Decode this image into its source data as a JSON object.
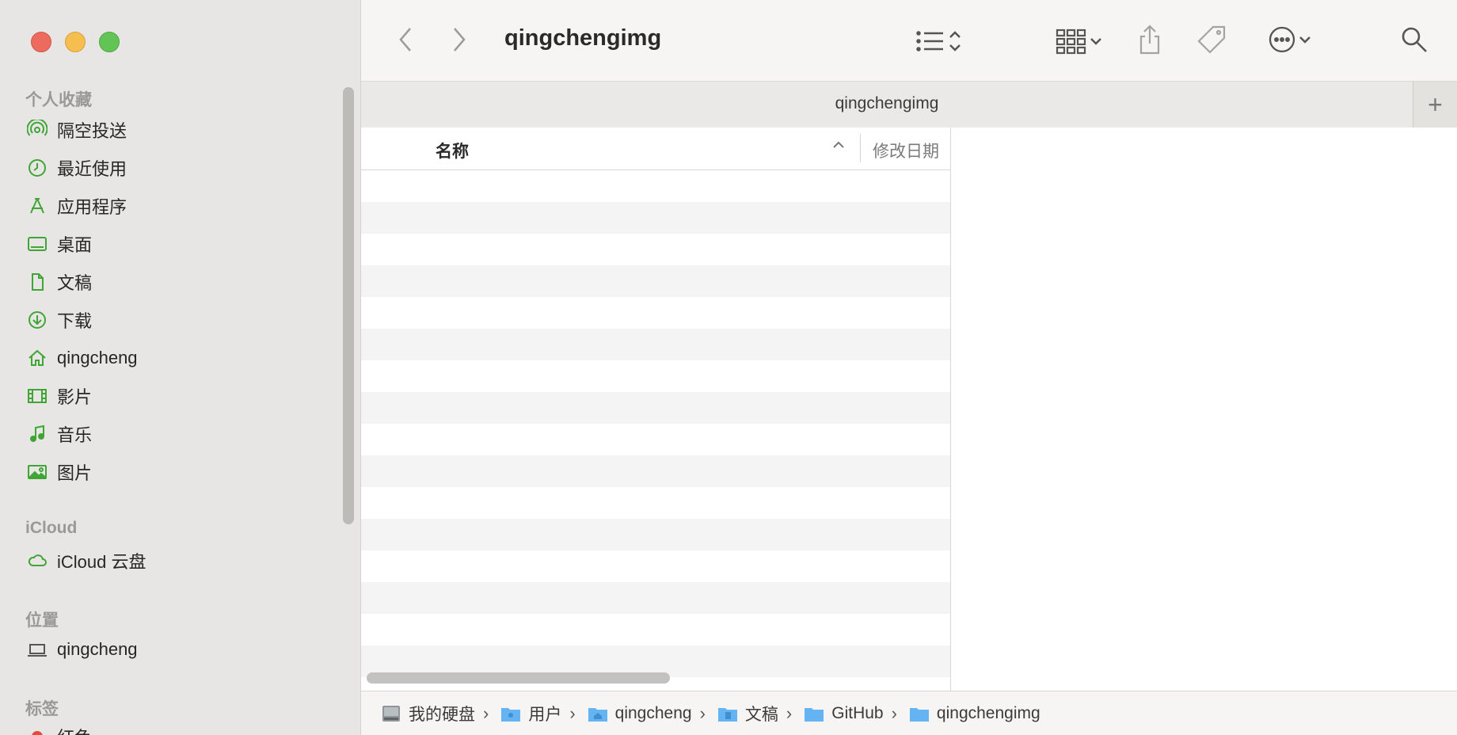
{
  "window": {
    "title": "qingchengimg"
  },
  "sidebar": {
    "sections": [
      {
        "label": "个人收藏"
      },
      {
        "label": "iCloud"
      },
      {
        "label": "位置"
      },
      {
        "label": "标签"
      }
    ],
    "favorites": [
      {
        "label": "隔空投送",
        "icon": "airdrop-icon"
      },
      {
        "label": "最近使用",
        "icon": "clock-icon"
      },
      {
        "label": "应用程序",
        "icon": "applications-icon"
      },
      {
        "label": "桌面",
        "icon": "desktop-icon"
      },
      {
        "label": "文稿",
        "icon": "document-icon"
      },
      {
        "label": "下载",
        "icon": "download-icon"
      },
      {
        "label": "qingcheng",
        "icon": "home-icon"
      },
      {
        "label": "影片",
        "icon": "film-icon"
      },
      {
        "label": "音乐",
        "icon": "music-icon"
      },
      {
        "label": "图片",
        "icon": "photo-icon"
      }
    ],
    "icloud": [
      {
        "label": "iCloud 云盘",
        "icon": "cloud-icon"
      }
    ],
    "locations": [
      {
        "label": "qingcheng",
        "icon": "laptop-icon"
      }
    ],
    "tags": [
      {
        "label": "红色",
        "color": "#e5483e"
      }
    ],
    "accent": "#3fa535"
  },
  "tab": {
    "title": "qingchengimg",
    "add": "+"
  },
  "list": {
    "columns": {
      "name": "名称",
      "date": "修改日期"
    },
    "sort": "^"
  },
  "pathbar": {
    "crumbs": [
      {
        "label": "我的硬盘",
        "icon": "hard-drive-icon"
      },
      {
        "label": "用户",
        "icon": "users-folder-icon"
      },
      {
        "label": "qingcheng",
        "icon": "home-folder-icon"
      },
      {
        "label": "文稿",
        "icon": "documents-folder-icon"
      },
      {
        "label": "GitHub",
        "icon": "folder-icon"
      },
      {
        "label": "qingchengimg",
        "icon": "folder-icon"
      }
    ],
    "separator": "›"
  }
}
